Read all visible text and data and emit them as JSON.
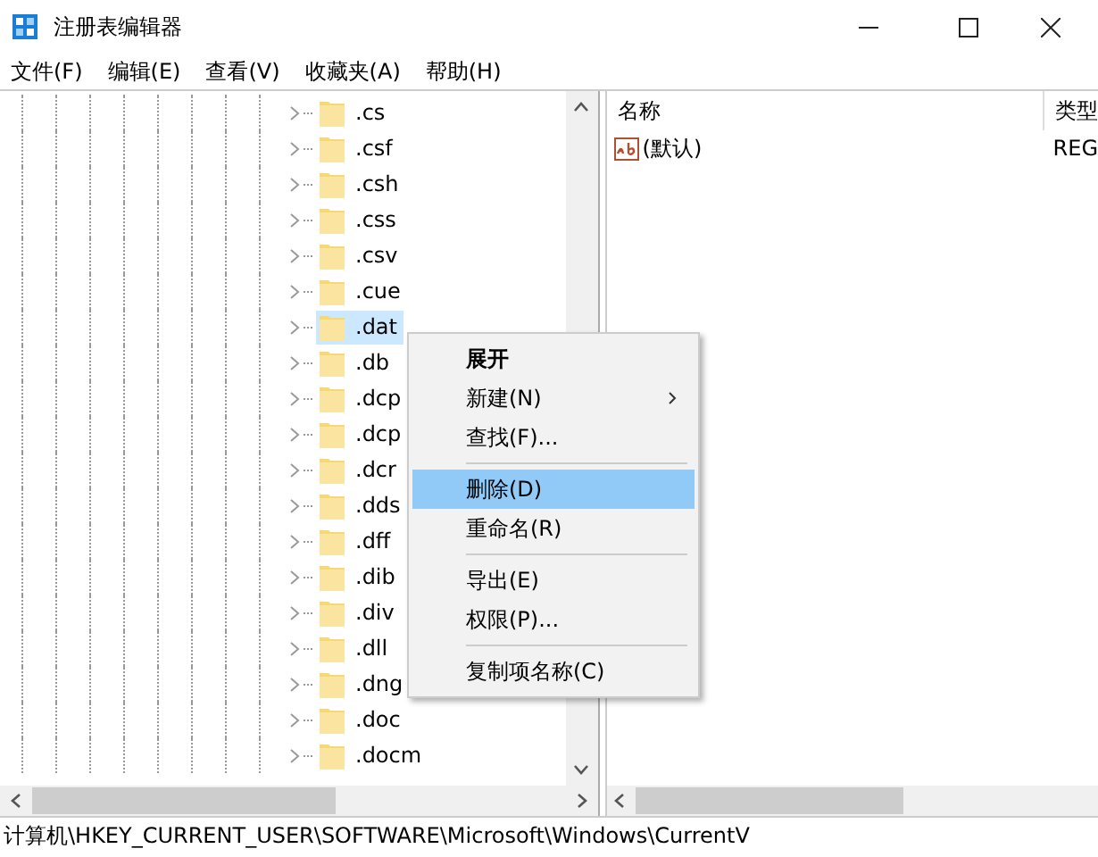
{
  "window": {
    "title": "注册表编辑器"
  },
  "menu_bar": [
    "文件(F)",
    "编辑(E)",
    "查看(V)",
    "收藏夹(A)",
    "帮助(H)"
  ],
  "tree": {
    "items": [
      {
        "label": ".cs",
        "selected": false
      },
      {
        "label": ".csf",
        "selected": false
      },
      {
        "label": ".csh",
        "selected": false
      },
      {
        "label": ".css",
        "selected": false
      },
      {
        "label": ".csv",
        "selected": false
      },
      {
        "label": ".cue",
        "selected": false
      },
      {
        "label": ".dat",
        "selected": true
      },
      {
        "label": ".db",
        "selected": false
      },
      {
        "label": ".dcp",
        "selected": false
      },
      {
        "label": ".dcp",
        "selected": false
      },
      {
        "label": ".dcr",
        "selected": false
      },
      {
        "label": ".dds",
        "selected": false
      },
      {
        "label": ".dff",
        "selected": false
      },
      {
        "label": ".dib",
        "selected": false
      },
      {
        "label": ".div",
        "selected": false
      },
      {
        "label": ".dll",
        "selected": false
      },
      {
        "label": ".dng",
        "selected": false
      },
      {
        "label": ".doc",
        "selected": false
      },
      {
        "label": ".docm",
        "selected": false
      }
    ]
  },
  "values": {
    "columns": [
      "名称",
      "类型"
    ],
    "rows": [
      {
        "name": "(默认)",
        "type": "REG"
      }
    ]
  },
  "context_menu": {
    "items": [
      {
        "kind": "item",
        "label": "展开",
        "bold": true,
        "selected": false,
        "submenu": false
      },
      {
        "kind": "item",
        "label": "新建(N)",
        "bold": false,
        "selected": false,
        "submenu": true
      },
      {
        "kind": "item",
        "label": "查找(F)...",
        "bold": false,
        "selected": false,
        "submenu": false
      },
      {
        "kind": "separator"
      },
      {
        "kind": "item",
        "label": "删除(D)",
        "bold": false,
        "selected": true,
        "submenu": false
      },
      {
        "kind": "item",
        "label": "重命名(R)",
        "bold": false,
        "selected": false,
        "submenu": false
      },
      {
        "kind": "separator"
      },
      {
        "kind": "item",
        "label": "导出(E)",
        "bold": false,
        "selected": false,
        "submenu": false
      },
      {
        "kind": "item",
        "label": "权限(P)...",
        "bold": false,
        "selected": false,
        "submenu": false
      },
      {
        "kind": "separator"
      },
      {
        "kind": "item",
        "label": "复制项名称(C)",
        "bold": false,
        "selected": false,
        "submenu": false
      }
    ]
  },
  "status_bar": "计算机\\HKEY_CURRENT_USER\\SOFTWARE\\Microsoft\\Windows\\CurrentV"
}
